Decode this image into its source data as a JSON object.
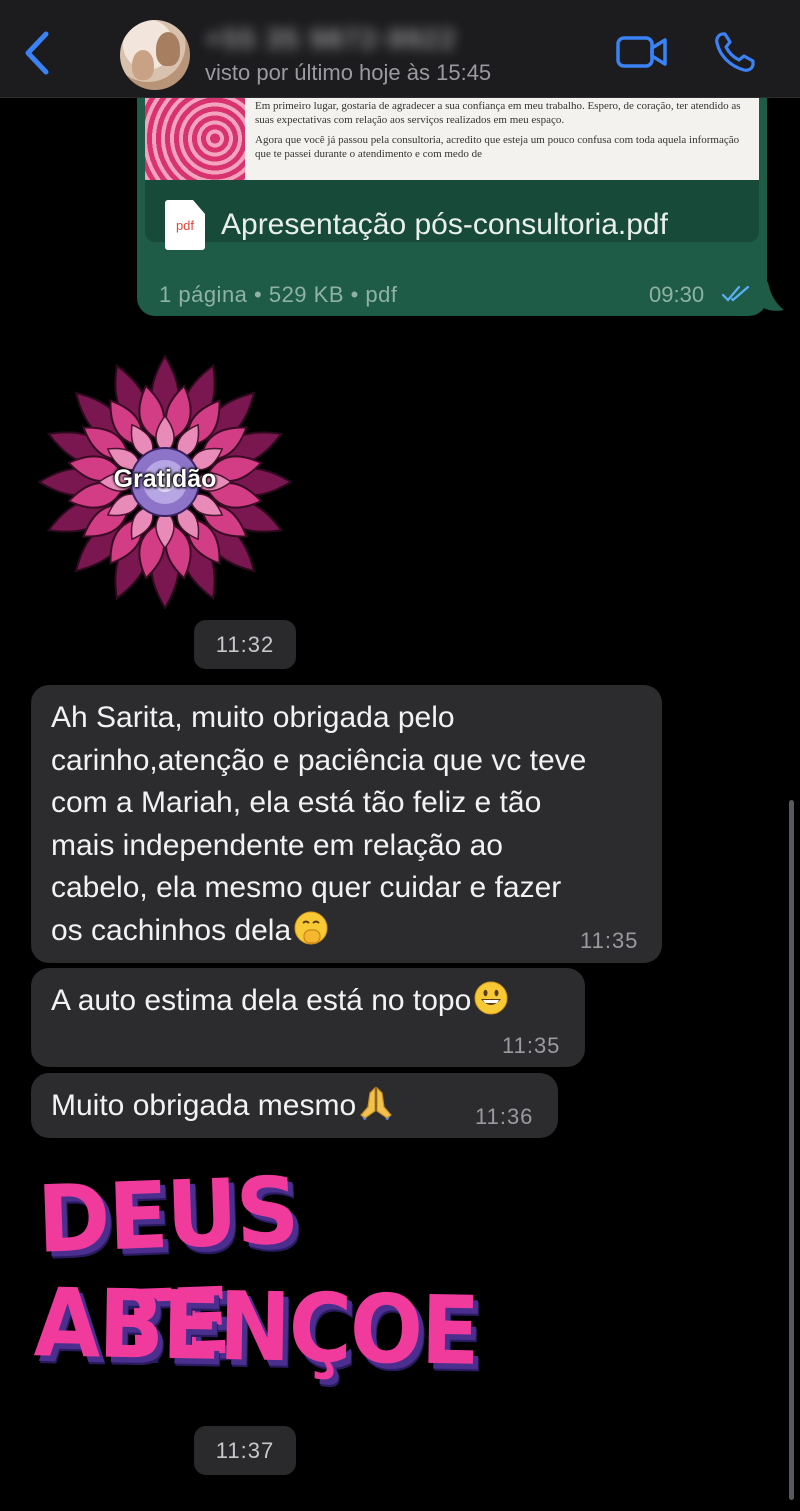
{
  "header": {
    "contact_name": "+55 35 9872-9922",
    "last_seen": "visto por último hoje às 15:45"
  },
  "document_message": {
    "preview_lines": [
      "Em primeiro lugar, gostaria de agradecer a sua confiança em meu trabalho. Espero,",
      "de coração, ter atendido as suas expectativas com relação aos serviços realizados em",
      "meu espaço.",
      "Agora que você já passou pela consultoria, acredito que esteja um pouco confusa",
      "com toda aquela informação que te passei durante o atendimento e com medo de"
    ],
    "file_icon_label": "pdf",
    "file_name": "Apresentação pós-consultoria.pdf",
    "file_meta": "1 página • 529 KB • pdf",
    "time": "09:30",
    "status": "read"
  },
  "sticker_1": {
    "label": "Gratidão",
    "time": "11:32"
  },
  "messages": [
    {
      "lines": [
        "Ah Sarita, muito obrigada pelo",
        "carinho,atenção e paciência que vc teve",
        "com a Mariah, ela está tão feliz e tão",
        "mais independente em relação ao",
        "cabelo, ela mesmo quer cuidar e fazer",
        "os cachinhos dela"
      ],
      "emoji": "face-with-hand-over-mouth",
      "time": "11:35"
    },
    {
      "text": "A auto estima dela está no topo",
      "emoji": "grinning-face",
      "time": "11:35"
    },
    {
      "text": "Muito obrigada mesmo",
      "emoji": "folded-hands",
      "time": "11:36"
    }
  ],
  "sticker_2": {
    "line1": "DEUS TE",
    "line2": "ABENÇOE",
    "time": "11:37"
  },
  "colors": {
    "outgoing_bubble": "#1f5c47",
    "incoming_bubble": "#2c2c2e",
    "accent_blue": "#3b82f6",
    "sticker_pink": "#f03b9d"
  }
}
